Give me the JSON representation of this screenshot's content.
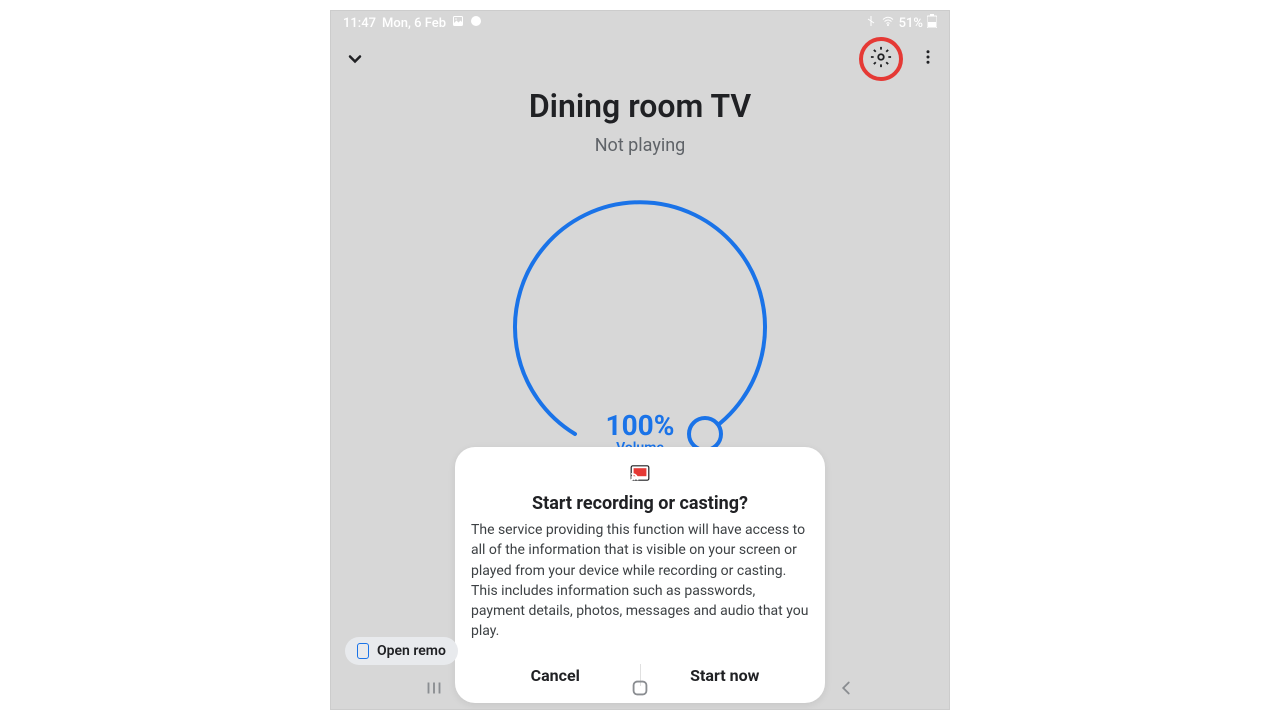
{
  "status_bar": {
    "time": "11:47",
    "date": "Mon, 6 Feb",
    "battery": "51%"
  },
  "header": {
    "title": "Dining room TV",
    "status": "Not playing"
  },
  "volume": {
    "percent": "100%",
    "label": "Volume"
  },
  "dialog": {
    "title": "Start recording or casting?",
    "body": "The service providing this function will have access to all of the information that is visible on your screen or played from your device while recording or casting. This includes information such as passwords, payment details, photos, messages and audio that you play.",
    "cancel": "Cancel",
    "confirm": "Start now"
  },
  "pill": {
    "label": "Open remo"
  },
  "colors": {
    "accent": "#1a73e8",
    "highlight_ring": "#e53935"
  }
}
